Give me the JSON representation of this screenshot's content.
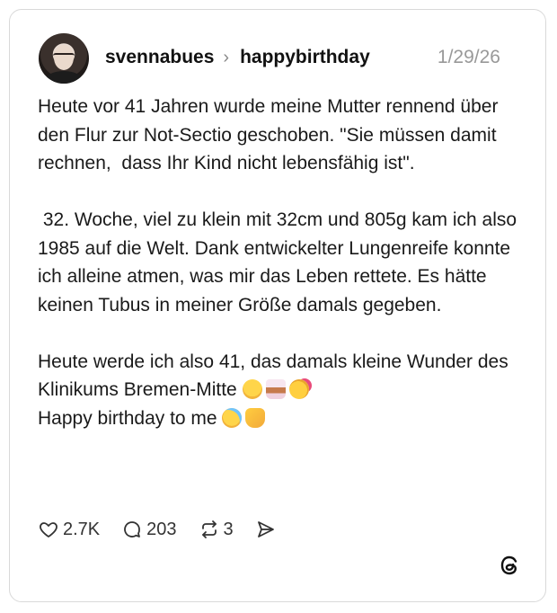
{
  "post": {
    "username": "svennabues",
    "channel": "happybirthday",
    "date": "1/29/26",
    "paragraph1": "Heute vor 41 Jahren wurde meine Mutter rennend über den Flur zur Not-Sectio geschoben. \"Sie müssen damit rechnen,  dass Ihr Kind nicht lebensfähig ist\".",
    "paragraph2": " 32. Woche, viel zu klein mit 32cm und 805g kam ich also 1985 auf die Welt. Dank entwickelter Lungenreife konnte ich alleine atmen, was mir das Leben rettete. Es hätte keinen Tubus in meiner Größe damals gegeben.",
    "paragraph3_line1": "Heute werde ich also 41, das damals kleine Wunder des Klinikums Bremen-Mitte",
    "paragraph3_line2": "Happy birthday to me"
  },
  "actions": {
    "likes": "2.7K",
    "comments": "203",
    "reposts": "3"
  },
  "icons": {
    "like": "heart-icon",
    "comment": "comment-bubble-icon",
    "repost": "repost-icon",
    "share": "send-icon",
    "brand": "threads-logo-icon"
  }
}
